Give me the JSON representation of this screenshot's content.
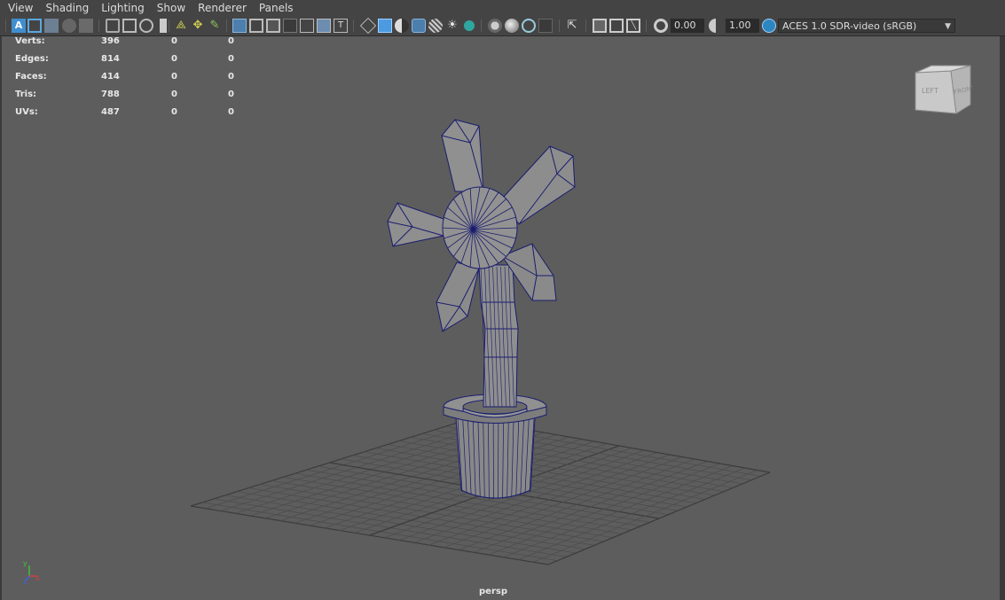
{
  "menus": [
    "View",
    "Shading",
    "Lighting",
    "Show",
    "Renderer",
    "Panels"
  ],
  "toolbar": {
    "exposure_value": "0.00",
    "gamma_value": "1.00",
    "color_space": "ACES 1.0 SDR-video (sRGB)",
    "icons": [
      "select-camera-icon",
      "camera-attributes-icon",
      "bookmarks-icon",
      "image-plane-icon",
      "film-gate-icon",
      "resolution-gate-icon",
      "safe-action-icon",
      "field-chart-icon",
      "grid-icon",
      "wireframe-icon",
      "smooth-shade-icon",
      "lighting-icon",
      "textures-icon",
      "shadows-icon",
      "xray-icon",
      "isolate-select-icon",
      "exposure-icon",
      "gamma-icon",
      "color-management-icon"
    ]
  },
  "hud": {
    "rows": [
      {
        "label": "Verts:",
        "v1": "396",
        "v2": "0",
        "v3": "0"
      },
      {
        "label": "Edges:",
        "v1": "814",
        "v2": "0",
        "v3": "0"
      },
      {
        "label": "Faces:",
        "v1": "414",
        "v2": "0",
        "v3": "0"
      },
      {
        "label": "Tris:",
        "v1": "788",
        "v2": "0",
        "v3": "0"
      },
      {
        "label": "UVs:",
        "v1": "487",
        "v2": "0",
        "v3": "0"
      }
    ]
  },
  "viewport": {
    "camera_label": "persp",
    "viewcube": {
      "left_face": "LEFT",
      "front_face": "FRONT"
    },
    "axis": {
      "y": "y",
      "x": "x",
      "z": "z"
    }
  },
  "colors": {
    "background": "#5d5d5d",
    "grid": "#4a4a4a",
    "mesh": "#8a8a8a",
    "wire": "#1a1d6e"
  }
}
